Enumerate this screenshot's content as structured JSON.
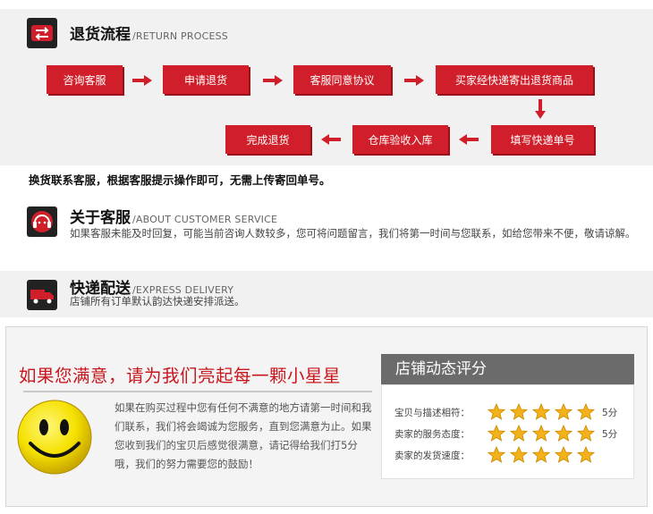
{
  "return_section": {
    "title": "退货流程",
    "subtitle": "/RETURN PROCESS",
    "icon": "return-arrows-icon",
    "steps": [
      "咨询客服",
      "申请退货",
      "客服同意协议",
      "买家经快递寄出退货商品",
      "填写快递单号",
      "仓库验收入库",
      "完成退货"
    ]
  },
  "exchange_note": "换货联系客服，根据客服提示操作即可，无需上传寄回单号。",
  "about_section": {
    "title": "关于客服",
    "subtitle": "/ABOUT CUSTOMER SERVICE",
    "icon": "headset-icon",
    "text": "如果客服未能及时回复，可能当前咨询人数较多，您可将问题留言，我们将第一时间与您联系，如给您带来不便，敬请谅解。"
  },
  "delivery_section": {
    "title": "快递配送",
    "subtitle": "/EXPRESS DELIVERY",
    "icon": "delivery-truck-icon",
    "text": "店铺所有订单默认韵达快递安排派送。"
  },
  "rating": {
    "title": "如果您满意，请为我们亮起每一颗小星星",
    "text": "如果在购买过程中您有任何不满意的地方请第一时间和我们联系，我们将会竭诚为您服务，直到您满意为止。如果您收到我们的宝贝后感觉很满意，请记得给我们打5分哦，我们的努力需要您的鼓励！",
    "icon": "smiley-face-icon"
  },
  "score_panel": {
    "title": "店铺动态评分",
    "rows": [
      {
        "label": "宝贝与描述相符：",
        "stars": 5,
        "value": "5分"
      },
      {
        "label": "卖家的服务态度：",
        "stars": 5,
        "value": "5分"
      },
      {
        "label": "卖家的发货速度：",
        "stars": 5,
        "value": ""
      }
    ]
  },
  "colors": {
    "accent_red": "#d01f2a",
    "dark_icon": "#222222",
    "score_header": "#6b6b6b",
    "star_gold": "#f3b21a"
  }
}
